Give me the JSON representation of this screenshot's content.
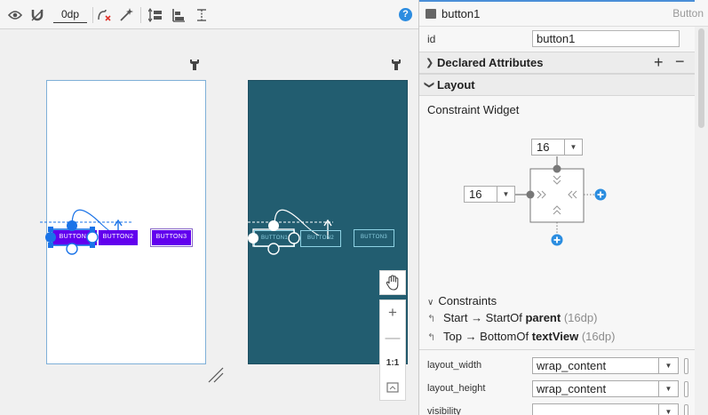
{
  "toolbar": {
    "margin_value": "0dp",
    "help_label": "?",
    "icons": [
      "eye-icon",
      "magnet-icon",
      "clear-constraints-icon",
      "infer-constraints-icon",
      "pack-icon",
      "align-icon",
      "guidelines-icon",
      "help-icon"
    ]
  },
  "design": {
    "buttons": [
      "BUTTON1",
      "BUTTON2",
      "BUTTON3"
    ],
    "blueprint_buttons": [
      "BUTTON1",
      "BUTTON2",
      "BUTTON3"
    ],
    "zoom": {
      "pan_icon": "hand-icon",
      "zoom_in": "+",
      "zoom_out": "—",
      "actual_size": "1:1",
      "fit_icon": "fit-screen-icon"
    },
    "colors": {
      "button": "#6200ee",
      "blueprint": "#225d70",
      "selection": "#1a73e8"
    }
  },
  "attributes": {
    "widget_name": "button1",
    "widget_type": "Button",
    "id_label": "id",
    "id_value": "button1",
    "declared_section": "Declared Attributes",
    "plus": "+",
    "minus": "−",
    "layout_section": "Layout",
    "constraint_widget_label": "Constraint Widget",
    "top_margin": "16",
    "start_margin": "16",
    "constraints_label": "Constraints",
    "constraints": [
      {
        "text": "Start → StartOf ",
        "target": "parent",
        "dp": " (16dp)"
      },
      {
        "text": "Top → BottomOf ",
        "target": "textView",
        "dp": " (16dp)"
      }
    ],
    "props": [
      {
        "label": "layout_width",
        "value": "wrap_content"
      },
      {
        "label": "layout_height",
        "value": "wrap_content"
      },
      {
        "label": "visibility",
        "value": ""
      }
    ]
  }
}
